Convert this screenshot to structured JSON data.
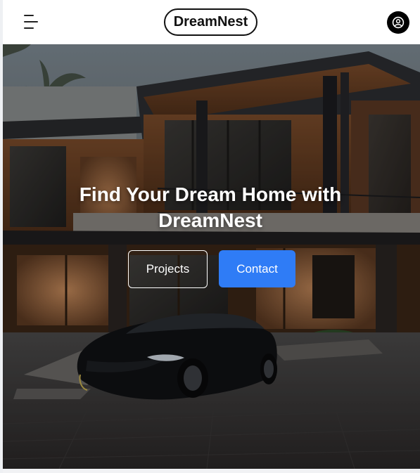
{
  "header": {
    "brand": "DreamNest",
    "menu_icon": "hamburger-menu-icon",
    "profile_icon": "user-circle-icon"
  },
  "hero": {
    "title": "Find Your Dream Home with DreamNest",
    "buttons": {
      "projects_label": "Projects",
      "contact_label": "Contact"
    },
    "background_image": "modern-house-with-black-sports-car"
  },
  "colors": {
    "accent": "#2f7cf6",
    "header_bg": "#ffffff",
    "text_dark": "#111111"
  }
}
